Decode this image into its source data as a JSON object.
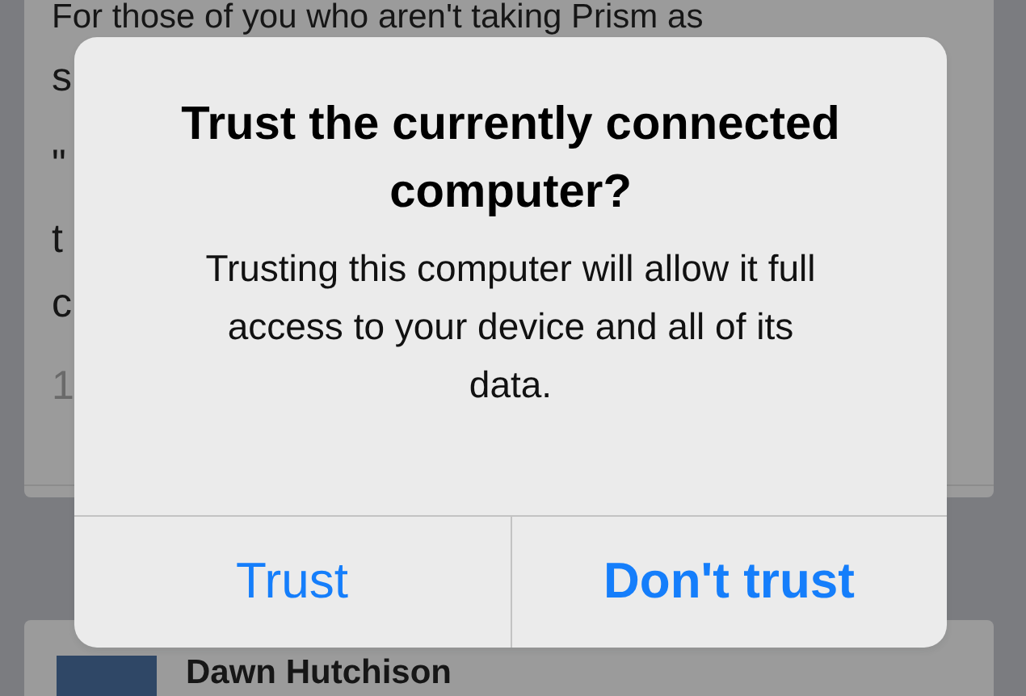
{
  "post": {
    "first_line": "For those of you who aren't taking Prism as",
    "fragments": [
      {
        "text": "s",
        "muted": false
      },
      {
        "text": "\"",
        "muted": false
      },
      {
        "text": "t",
        "muted": false
      },
      {
        "text": "c",
        "muted": false
      },
      {
        "text": "1",
        "muted": true
      }
    ]
  },
  "next_post": {
    "author": "Dawn Hutchison"
  },
  "alert": {
    "title": "Trust the currently connected computer?",
    "message": "Trusting this computer will allow it full access to your device and all of its data.",
    "buttons": [
      {
        "label": "Trust",
        "primary": false
      },
      {
        "label": "Don't trust",
        "primary": true
      }
    ]
  }
}
